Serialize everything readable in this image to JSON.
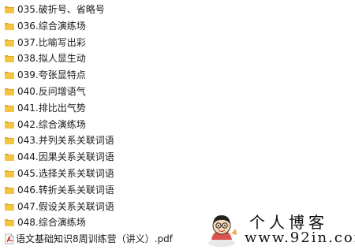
{
  "colors": {
    "folder_body": "#f5c542",
    "folder_tab": "#e0a92a",
    "pdf_red": "#d93025",
    "text": "#1a1a1a"
  },
  "files": [
    {
      "name": "035.破折号、省略号",
      "type": "folder",
      "icon": "folder-icon"
    },
    {
      "name": "036.综合演练场",
      "type": "folder",
      "icon": "folder-icon"
    },
    {
      "name": "037.比喻写出彩",
      "type": "folder",
      "icon": "folder-icon"
    },
    {
      "name": "038.拟人显生动",
      "type": "folder",
      "icon": "folder-icon"
    },
    {
      "name": "039.夸张显特点",
      "type": "folder",
      "icon": "folder-icon"
    },
    {
      "name": "040.反问增语气",
      "type": "folder",
      "icon": "folder-icon"
    },
    {
      "name": "041.排比出气势",
      "type": "folder",
      "icon": "folder-icon"
    },
    {
      "name": "042.综合演练场",
      "type": "folder",
      "icon": "folder-icon"
    },
    {
      "name": "043.并列关系关联词语",
      "type": "folder",
      "icon": "folder-icon"
    },
    {
      "name": "044.因果关系关联词语",
      "type": "folder",
      "icon": "folder-icon"
    },
    {
      "name": "045.选择关系关联词语",
      "type": "folder",
      "icon": "folder-icon"
    },
    {
      "name": "046.转折关系关联词语",
      "type": "folder",
      "icon": "folder-icon"
    },
    {
      "name": "047.假设关系关联词语",
      "type": "folder",
      "icon": "folder-icon"
    },
    {
      "name": "048.综合演练场",
      "type": "folder",
      "icon": "folder-icon"
    },
    {
      "name": "语文基础知识8周训练营（讲义）.pdf",
      "type": "pdf",
      "icon": "pdf-file-icon"
    }
  ],
  "watermark": {
    "title": "个人博客",
    "url": "www.92in.com"
  }
}
